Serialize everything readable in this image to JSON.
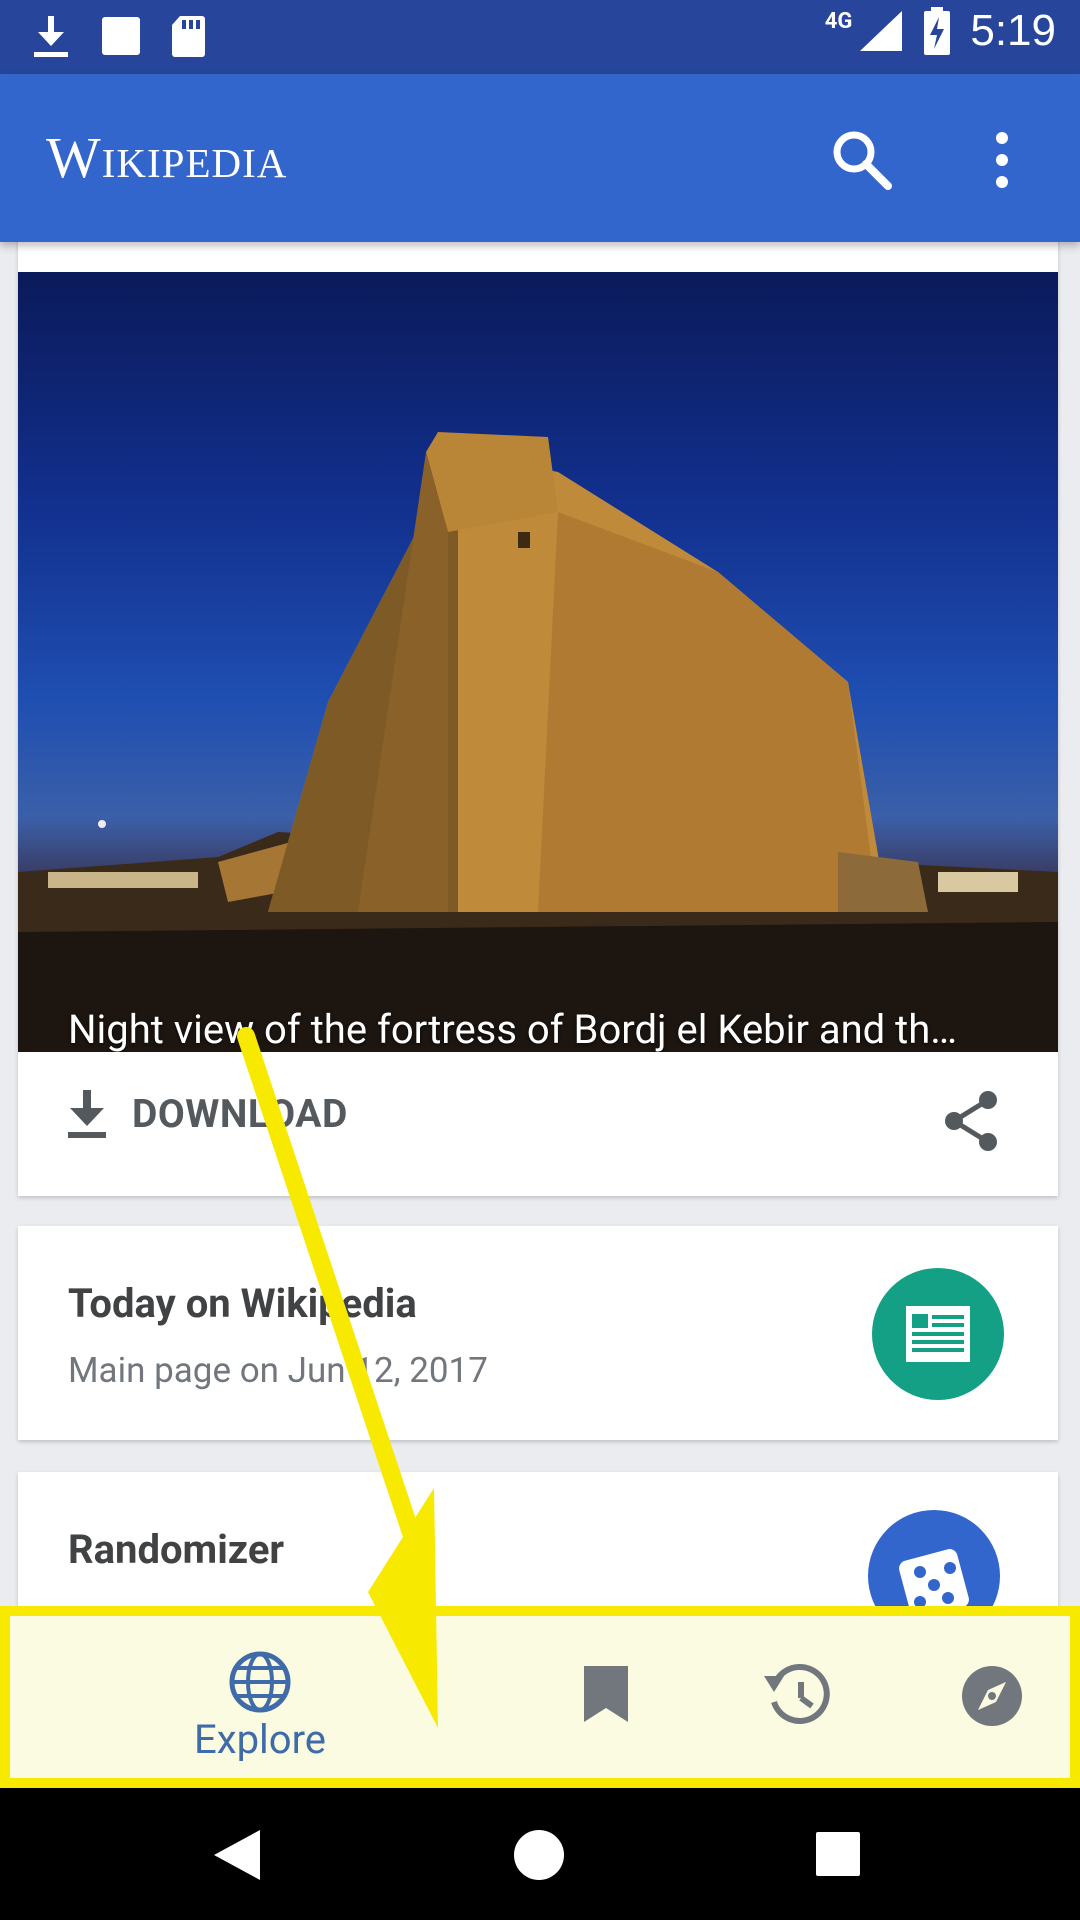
{
  "status_bar": {
    "time": "5:19",
    "network": "4G",
    "left_icons": [
      "download-icon",
      "square-icon",
      "sd-card-icon"
    ],
    "right_icons": [
      "signal-icon",
      "battery-charging-icon"
    ]
  },
  "app_bar": {
    "title": "Wikipedia",
    "actions": [
      "search-icon",
      "overflow-menu-icon"
    ]
  },
  "featured_image": {
    "caption": "Night view of the fortress of Bordj el Kebir and th…",
    "download_label": "DOWNLOAD",
    "actions": [
      "download-icon",
      "share-icon"
    ]
  },
  "today_card": {
    "title": "Today on Wikipedia",
    "subtitle": "Main page on Jun 12, 2017",
    "icon": "news-icon",
    "icon_color": "#14a085"
  },
  "random_card": {
    "title": "Randomizer",
    "icon": "dice-icon",
    "icon_color": "#3366cc"
  },
  "bottom_nav": {
    "explore_label": "Explore",
    "items": [
      "globe-icon",
      "bookmark-icon",
      "history-icon",
      "compass-icon"
    ],
    "active": "Explore"
  },
  "system_nav": [
    "back-icon",
    "home-icon",
    "recents-icon"
  ],
  "colors": {
    "app_bar": "#3366cc",
    "status_bar": "#27469b",
    "highlight": "#f7ea00",
    "active_nav": "#3f6ba9"
  }
}
